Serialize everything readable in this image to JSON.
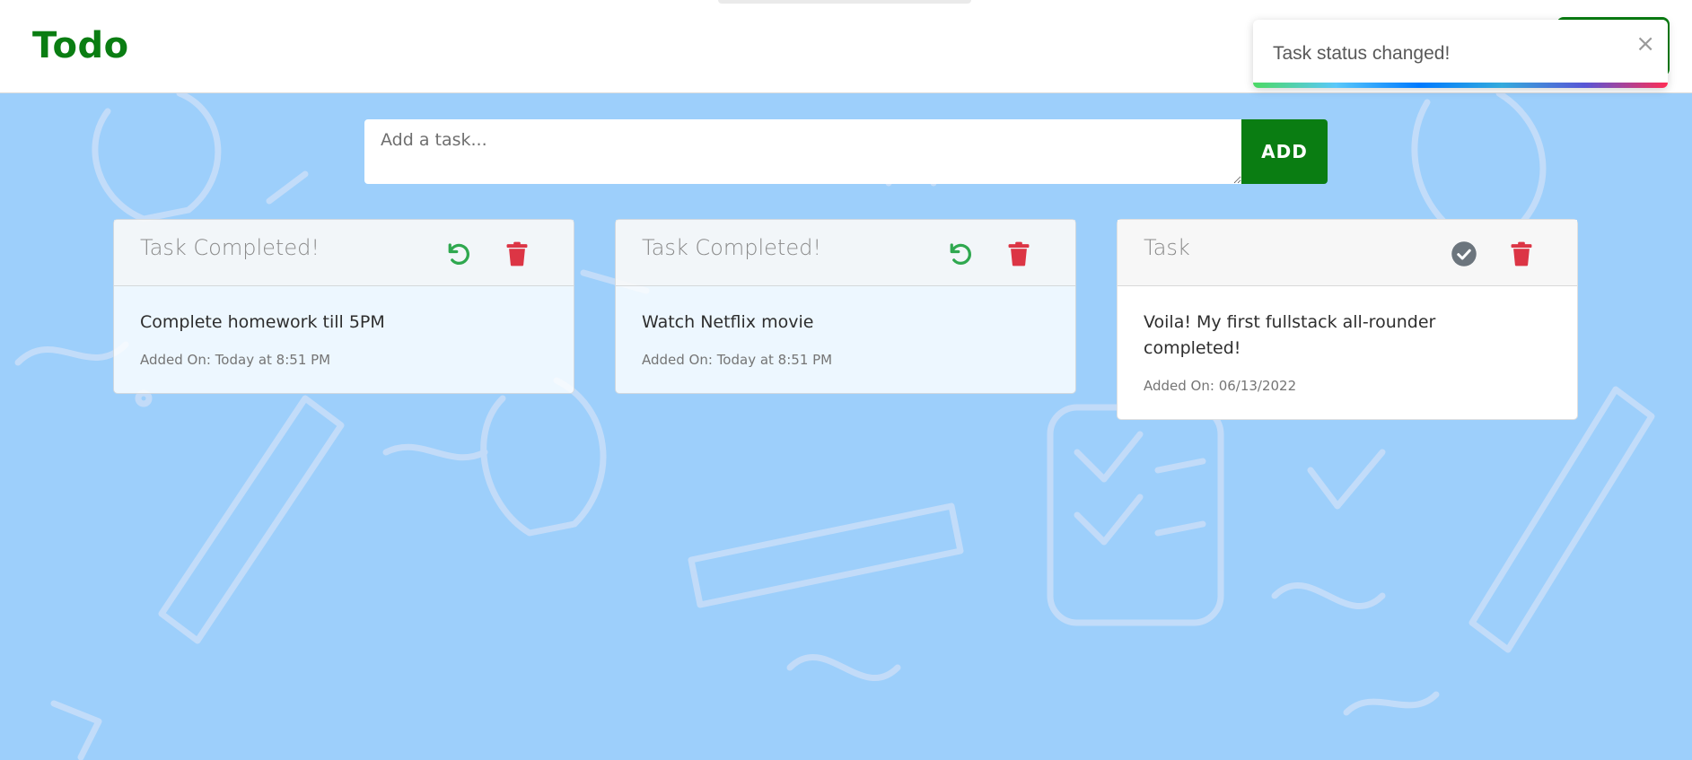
{
  "brand": {
    "title": "Todo",
    "color": "#0a7d12"
  },
  "toast": {
    "message": "Task status changed!",
    "close_glyph": "×"
  },
  "composer": {
    "placeholder": "Add a task...",
    "add_label": "ADD"
  },
  "cards": [
    {
      "title": "Task Completed!",
      "text": "Complete homework till 5PM",
      "date": "Added On: Today at 8:51 PM",
      "status": "completed",
      "action_icon": "undo-icon",
      "delete_icon": "trash-icon"
    },
    {
      "title": "Task Completed!",
      "text": "Watch Netflix movie",
      "date": "Added On: Today at 8:51 PM",
      "status": "completed",
      "action_icon": "undo-icon",
      "delete_icon": "trash-icon"
    },
    {
      "title": "Task",
      "text": "Voila! My first fullstack all-rounder completed!",
      "date": "Added On: 06/13/2022",
      "status": "pending",
      "action_icon": "check-circle-icon",
      "delete_icon": "trash-icon"
    }
  ],
  "colors": {
    "background": "#9dcffb",
    "undo": "#2fa84f",
    "delete": "#dc3545",
    "check": "#6c757d"
  }
}
